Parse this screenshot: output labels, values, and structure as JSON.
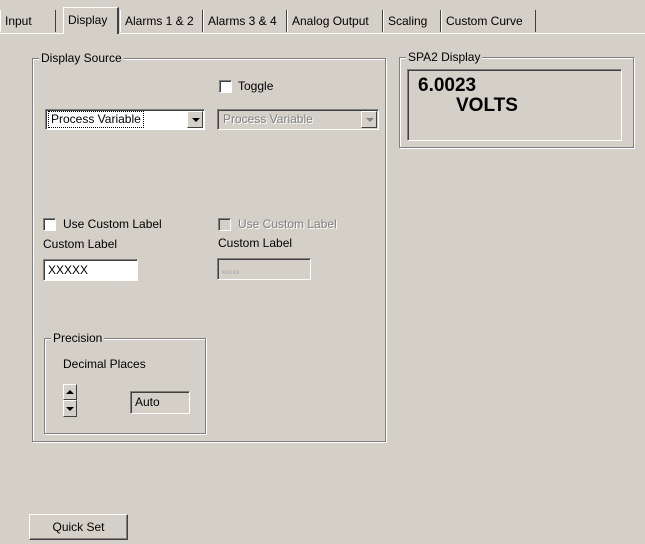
{
  "tabs": [
    {
      "label": "Input"
    },
    {
      "label": "Display"
    },
    {
      "label": "Alarms 1 & 2"
    },
    {
      "label": "Alarms 3 & 4"
    },
    {
      "label": "Analog Output"
    },
    {
      "label": "Scaling"
    },
    {
      "label": "Custom Curve"
    }
  ],
  "active_tab": "Display",
  "display_source": {
    "title": "Display Source",
    "toggle_label": "Toggle",
    "toggle_checked": false,
    "primary_source": "Process Variable",
    "secondary_source": "Process Variable",
    "use_custom_label_1": "Use Custom Label",
    "use_custom_label_1_checked": false,
    "use_custom_label_2": "Use Custom Label",
    "use_custom_label_2_checked": false,
    "custom_label_caption_1": "Custom Label",
    "custom_label_caption_2": "Custom Label",
    "custom_label_value_1": "XXXXX",
    "custom_label_value_2": "xxxxx"
  },
  "precision": {
    "title": "Precision",
    "decimal_places_label": "Decimal Places",
    "value": "Auto"
  },
  "spa2_display": {
    "title": "SPA2 Display",
    "line1": "6.0023",
    "line2": "VOLTS"
  },
  "quick_set_label": "Quick Set"
}
